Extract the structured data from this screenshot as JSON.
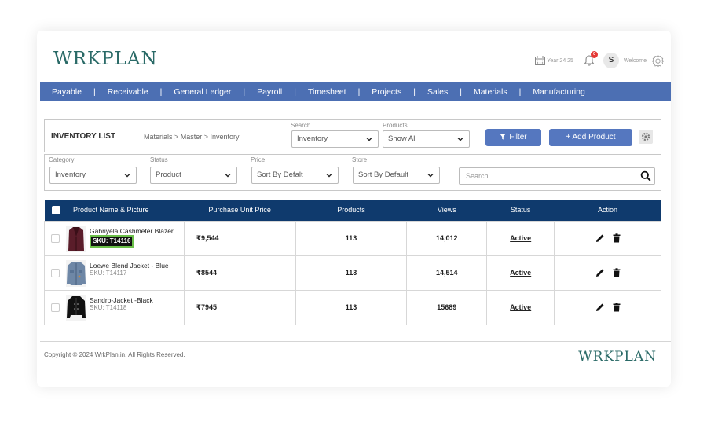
{
  "brand": {
    "logo_text": "WRKPLAN",
    "color": "#2a6a67"
  },
  "header": {
    "year_label": "Year 24 25",
    "notification_count": "0",
    "avatar_initial": "S",
    "welcome_text": "Welcome"
  },
  "nav": {
    "color": "#4c6fb3",
    "items": [
      "Payable",
      "Receivable",
      "General Ledger",
      "Payroll",
      "Timesheet",
      "Projects",
      "Sales",
      "Materials",
      "Manufacturing"
    ]
  },
  "toolbar": {
    "title": "INVENTORY LIST",
    "breadcrumb": "Materials > Master > Inventory",
    "search_label": "Search",
    "search_value": "Inventory",
    "products_label": "Products",
    "products_value": "Show All",
    "filter_label": "Filter",
    "add_label": "+ Add Product"
  },
  "filters": {
    "category_label": "Category",
    "category_value": "Inventory",
    "status_label": "Status",
    "status_value": "Product",
    "price_label": "Price",
    "price_value": "Sort By Defalt",
    "store_label": "Store",
    "store_value": "Sort By Default",
    "search_placeholder": "Search"
  },
  "table": {
    "header_color": "#0f3a6d",
    "columns": [
      "Product Name & Picture",
      "Purchase Unit Price",
      "Products",
      "Views",
      "Status",
      "Action"
    ],
    "rows": [
      {
        "name": "Gabriyela Cashmeter Blazer",
        "sku": "SKU: T14116",
        "price": "₹9,544",
        "products": "113",
        "views": "14,012",
        "status": "Active",
        "thumb_icon": "blazer-icon"
      },
      {
        "name": "Loewe Blend Jacket - Blue",
        "sku": "SKU: T14117",
        "price": "₹8544",
        "products": "113",
        "views": "14,514",
        "status": "Active",
        "thumb_icon": "denim-jacket-icon"
      },
      {
        "name": "Sandro-Jacket -Black",
        "sku": "SKU: T14118",
        "price": "₹7945",
        "products": "113",
        "views": "15689",
        "status": "Active",
        "thumb_icon": "black-jacket-icon"
      }
    ]
  },
  "footer": {
    "copyright": "Copyright © 2024 WrkPlan.in. All Rights Reserved.",
    "logo_text": "WRKPLAN"
  }
}
